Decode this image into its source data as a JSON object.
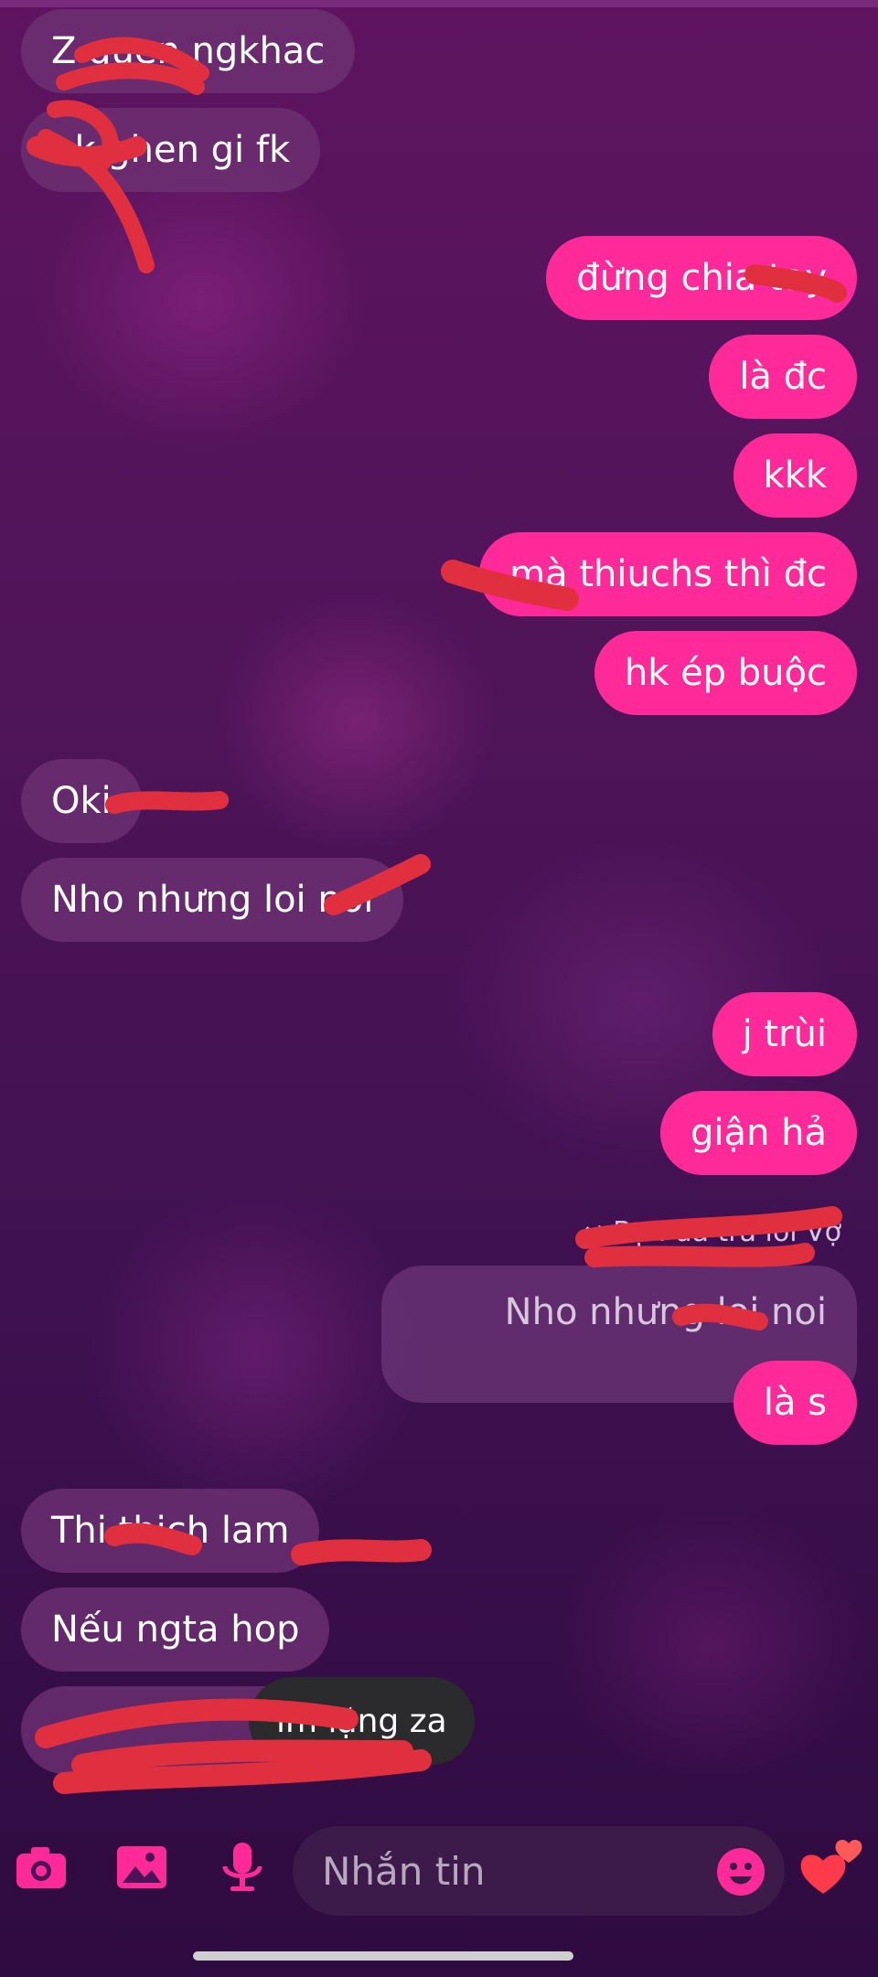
{
  "messages": [
    {
      "side": "in",
      "text": "Z quen ngkhac"
    },
    {
      "side": "in",
      "text": "hk ghen gi fk"
    },
    {
      "side": "out",
      "text": "đừng chia tay"
    },
    {
      "side": "out",
      "text": "là đc"
    },
    {
      "side": "out",
      "text": "kkk"
    },
    {
      "side": "out",
      "text": "mà thiuchs thì đc"
    },
    {
      "side": "out",
      "text": "hk ép buộc"
    },
    {
      "side": "in",
      "text": "Oki"
    },
    {
      "side": "in",
      "text": "Nho nhưng loi noi"
    },
    {
      "side": "out",
      "text": "j trùi"
    },
    {
      "side": "out",
      "text": "giận hả"
    },
    {
      "side": "out",
      "text": "là s"
    },
    {
      "side": "in",
      "text": "Thi thich lam"
    },
    {
      "side": "in",
      "text": "Nếu ngta hop"
    }
  ],
  "reply": {
    "label": "Bạn đã trả lời Vợ",
    "quoted_text": "Nho nhưng loi noi"
  },
  "toast": {
    "text": "im lặng za"
  },
  "composer": {
    "placeholder": "Nhắn tin",
    "icons": [
      "camera-icon",
      "image-icon",
      "microphone-icon",
      "emoji-icon",
      "hearts-icon"
    ]
  },
  "colors": {
    "outgoing_bubble": "#ff2a9a",
    "incoming_bubble": "#6e3273",
    "redaction": "#e0303f"
  }
}
